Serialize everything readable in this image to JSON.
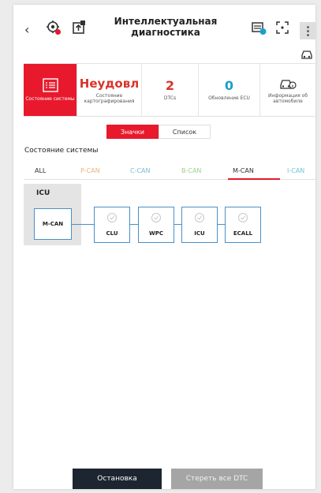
{
  "header": {
    "title_line1": "Интеллектуальная",
    "title_line2": "диагностика"
  },
  "summary": {
    "system_state_label": "Состояние системы",
    "mapping": {
      "value": "Неудовл",
      "label_line1": "Состояние",
      "label_line2": "картографирования"
    },
    "dtcs": {
      "value": "2",
      "label": "DTCs"
    },
    "ecu_update": {
      "value": "0",
      "label": "Обновление ECU"
    },
    "vehicle_info": {
      "label_line1": "Информация об",
      "label_line2": "автомобиле"
    }
  },
  "view_toggle": {
    "icons": "Значки",
    "list": "Список"
  },
  "section_title": "Состояние системы",
  "can_tabs": [
    {
      "label": "ALL",
      "color": "#333333"
    },
    {
      "label": "P-CAN",
      "color": "#f0b27a"
    },
    {
      "label": "C-CAN",
      "color": "#7fb8d6"
    },
    {
      "label": "B-CAN",
      "color": "#9fcf8a"
    },
    {
      "label": "M-CAN",
      "color": "#333333"
    },
    {
      "label": "I-CAN",
      "color": "#6fc5d8"
    }
  ],
  "active_tab": "M-CAN",
  "diagram": {
    "group_label": "ICU",
    "bus_label": "M-CAN",
    "ecus": [
      "CLU",
      "WPC",
      "ICU",
      "ECALL"
    ]
  },
  "buttons": {
    "stop": "Остановка",
    "clear_dtc": "Стереть все DTC"
  },
  "colors": {
    "accent": "#e8192c",
    "dtc_count": "#d9342b",
    "ecu_update": "#1aa0c8",
    "dark_button": "#1c2530"
  }
}
